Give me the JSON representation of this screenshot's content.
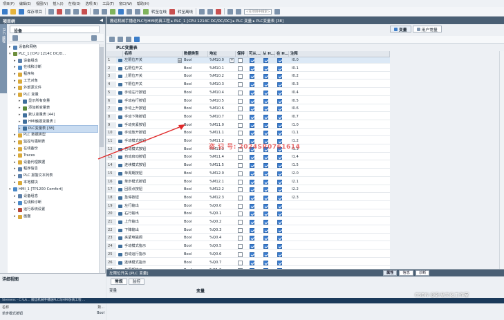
{
  "menubar": [
    "项目(P)",
    "编辑(E)",
    "视图(V)",
    "插入(I)",
    "在线(O)",
    "选项(N)",
    "工具(T)",
    "窗口(W)",
    "帮助(H)"
  ],
  "toolbar": {
    "save_label": "保存项目",
    "online": "转至在线",
    "offline": "转至离线",
    "search_placeholder": "<在项目中搜索>"
  },
  "left_panel": {
    "title": "项目树",
    "vertical_tab": "PLC 编程",
    "devices_tab": "设备",
    "tree": [
      {
        "label": "设备和网络",
        "depth": 1,
        "icon": "network-icon",
        "color": "#4f7fb3"
      },
      {
        "label": "PLC_1 [CPU 1214C DC/D...",
        "depth": 1,
        "icon": "cpu-icon",
        "color": "#6c8e3c",
        "expanded": true
      },
      {
        "label": "设备组态",
        "depth": 2,
        "icon": "device-config-icon",
        "color": "#5b7faa"
      },
      {
        "label": "在线和诊断",
        "depth": 2,
        "icon": "diagnostics-icon",
        "color": "#4a88c7"
      },
      {
        "label": "程序块",
        "depth": 2,
        "icon": "folder-icon",
        "color": "#d9a93a"
      },
      {
        "label": "工艺对象",
        "depth": 2,
        "icon": "folder-icon",
        "color": "#d9a93a"
      },
      {
        "label": "外部源文件",
        "depth": 2,
        "icon": "folder-icon",
        "color": "#d9a93a"
      },
      {
        "label": "PLC 变量",
        "depth": 2,
        "icon": "folder-icon",
        "color": "#d9a93a",
        "expanded": true
      },
      {
        "label": "显示所有变量",
        "depth": 3,
        "icon": "tag-table-icon",
        "color": "#3f6f9c"
      },
      {
        "label": "添加新变量表",
        "depth": 3,
        "icon": "add-table-icon",
        "color": "#5a8a3a"
      },
      {
        "label": "默认变量表 [44]",
        "depth": 3,
        "icon": "tag-table-icon",
        "color": "#3f6f9c"
      },
      {
        "label": "HMI触摸变量表 [",
        "depth": 3,
        "icon": "tag-table-icon",
        "color": "#3f6f9c"
      },
      {
        "label": "PLC变量表 [38]",
        "depth": 3,
        "icon": "tag-table-icon",
        "color": "#3f6f9c",
        "selected": true
      },
      {
        "label": "PLC 数据类型",
        "depth": 2,
        "icon": "folder-icon",
        "color": "#d9a93a"
      },
      {
        "label": "监控与强制表",
        "depth": 2,
        "icon": "folder-icon",
        "color": "#d9a93a"
      },
      {
        "label": "在线备份",
        "depth": 2,
        "icon": "folder-icon",
        "color": "#d9a93a"
      },
      {
        "label": "Traces",
        "depth": 2,
        "icon": "folder-icon",
        "color": "#d9a93a"
      },
      {
        "label": "设备代理数据",
        "depth": 2,
        "icon": "folder-icon",
        "color": "#d9a93a"
      },
      {
        "label": "程序信息",
        "depth": 2,
        "icon": "program-info-icon",
        "color": "#5b7faa"
      },
      {
        "label": "PLC 报警文本列表",
        "depth": 2,
        "icon": "alarm-list-icon",
        "color": "#5b7faa"
      },
      {
        "label": "本地模块",
        "depth": 2,
        "icon": "folder-icon",
        "color": "#d9a93a"
      },
      {
        "label": "HMI_1 [TP1200 Comfort]",
        "depth": 1,
        "icon": "hmi-icon",
        "color": "#4a88c7",
        "expanded": true
      },
      {
        "label": "设备组态",
        "depth": 2,
        "icon": "device-config-icon",
        "color": "#5b7faa"
      },
      {
        "label": "在线和诊断",
        "depth": 2,
        "icon": "diagnostics-icon",
        "color": "#4a88c7"
      },
      {
        "label": "运行系统设置",
        "depth": 2,
        "icon": "runtime-settings-icon",
        "color": "#b5453a"
      },
      {
        "label": "画面",
        "depth": 2,
        "icon": "folder-icon",
        "color": "#d9a93a"
      }
    ],
    "detail": {
      "title": "详细视图",
      "col_name": "名称",
      "col_addr": "数...",
      "row_name": "单步模式按钮",
      "row_addr": "Bool"
    }
  },
  "editor": {
    "breadcrumb": "搬运机械手播送PLC与HMI仿真工程 ▸ PLC_1 [CPU 1214C DC/DC/DC] ▸ PLC 变量 ▸ PLC变量表 [38]",
    "view_tabs": [
      "变量",
      "用户常量"
    ],
    "table_title": "PLC变量表",
    "columns": [
      "名称",
      "数据类型",
      "地址",
      "保持",
      "可从...",
      "从 H...",
      "在 H...",
      "注释"
    ],
    "rows": [
      {
        "name": "左限位开关",
        "type": "Bool",
        "addr": "%M10.0",
        "c": "I0.0"
      },
      {
        "name": "右限位开关",
        "type": "Bool",
        "addr": "%M10.1",
        "c": "I0.1"
      },
      {
        "name": "上限位开关",
        "type": "Bool",
        "addr": "%M10.2",
        "c": "I0.2"
      },
      {
        "name": "下限位开关",
        "type": "Bool",
        "addr": "%M10.3",
        "c": "I0.3"
      },
      {
        "name": "手动左行按钮",
        "type": "Bool",
        "addr": "%M10.4",
        "c": "I0.4"
      },
      {
        "name": "手动右行按钮",
        "type": "Bool",
        "addr": "%M10.5",
        "c": "I0.5"
      },
      {
        "name": "手动上升按钮",
        "type": "Bool",
        "addr": "%M10.6",
        "c": "I0.6"
      },
      {
        "name": "手动下降按钮",
        "type": "Bool",
        "addr": "%M10.7",
        "c": "I0.7"
      },
      {
        "name": "手动夹紧按钮",
        "type": "Bool",
        "addr": "%M11.0",
        "c": "I1.0"
      },
      {
        "name": "手动放开按钮",
        "type": "Bool",
        "addr": "%M11.1",
        "c": "I1.1"
      },
      {
        "name": "手动模式按钮",
        "type": "Bool",
        "addr": "%M11.2",
        "c": "I1.2"
      },
      {
        "name": "自动模式按钮",
        "type": "Bool",
        "addr": "%M11.3",
        "c": "I1.3"
      },
      {
        "name": "自动启动按钮",
        "type": "Bool",
        "addr": "%M11.4",
        "c": "I1.4"
      },
      {
        "name": "连续模式按钮",
        "type": "Bool",
        "addr": "%M11.5",
        "c": "I1.5"
      },
      {
        "name": "单周期按钮",
        "type": "Bool",
        "addr": "%M12.0",
        "c": "I2.0"
      },
      {
        "name": "单步模式按钮",
        "type": "Bool",
        "addr": "%M12.1",
        "c": "I2.1"
      },
      {
        "name": "回原点按钮",
        "type": "Bool",
        "addr": "%M12.2",
        "c": "I2.2"
      },
      {
        "name": "急停按钮",
        "type": "Bool",
        "addr": "%M12.3",
        "c": "I2.3"
      },
      {
        "name": "左行输出",
        "type": "Bool",
        "addr": "%Q0.0",
        "c": ""
      },
      {
        "name": "右行输出",
        "type": "Bool",
        "addr": "%Q0.1",
        "c": ""
      },
      {
        "name": "上升输出",
        "type": "Bool",
        "addr": "%Q0.2",
        "c": ""
      },
      {
        "name": "下降输出",
        "type": "Bool",
        "addr": "%Q0.3",
        "c": ""
      },
      {
        "name": "夹紧电磁阀",
        "type": "Bool",
        "addr": "%Q0.4",
        "c": ""
      },
      {
        "name": "手动模式指示",
        "type": "Bool",
        "addr": "%Q0.5",
        "c": ""
      },
      {
        "name": "自动运行指示",
        "type": "Bool",
        "addr": "%Q0.6",
        "c": ""
      },
      {
        "name": "连续模式指示",
        "type": "Bool",
        "addr": "%Q0.7",
        "c": ""
      },
      {
        "name": "单周期指示",
        "type": "Bool",
        "addr": "%Q1.0",
        "c": ""
      }
    ]
  },
  "properties": {
    "title": "左限位开关 [PLC 变量]",
    "tabs": [
      "属性",
      "信息",
      "诊断"
    ],
    "general_tabs": [
      "常规",
      "监控"
    ],
    "nav_label": "变量",
    "section_title": "变量"
  },
  "watermark": "盗 记 号: 2024SR0761614",
  "taskbar": "Siemens - C:\\Us... 搬运机械手播送PLC与HMI仿真工程 ...",
  "csdn_mark": "CSDN @卧龙文化工作室"
}
